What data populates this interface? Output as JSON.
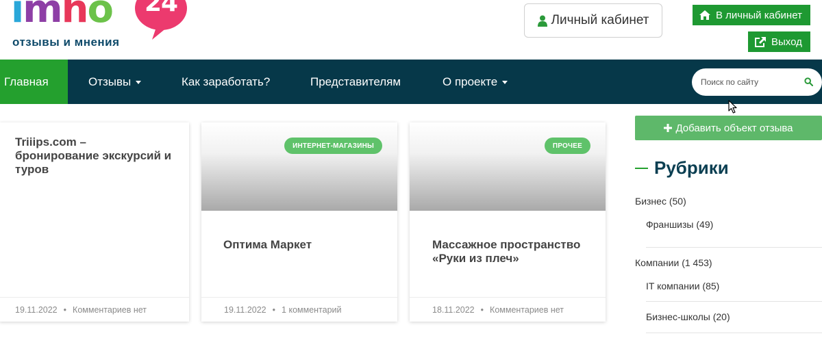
{
  "header": {
    "logo": {
      "letters": [
        "i",
        "m",
        "h",
        "o"
      ],
      "badge": "24",
      "tagline": "отзывы и мнения"
    },
    "cabinet_button": "Личный кабинет",
    "to_cabinet_button": "В личный кабинет",
    "logout_button": "Выход"
  },
  "nav": {
    "items": [
      {
        "label": "Главная",
        "active": true
      },
      {
        "label": "Отзывы",
        "dropdown": true
      },
      {
        "label": "Как заработать?"
      },
      {
        "label": "Представителям"
      },
      {
        "label": "О проекте",
        "dropdown": true
      }
    ],
    "search_placeholder": "Поиск по сайту"
  },
  "cards": [
    {
      "title": "Triiips.com – бронирование экскурсий и туров",
      "date": "19.11.2022",
      "comments": "Комментариев нет"
    },
    {
      "badge": "ИНТЕРНЕТ-МАГАЗИНЫ",
      "title": "Оптима Маркет",
      "date": "19.11.2022",
      "comments": "1 комментарий"
    },
    {
      "badge": "ПРОЧЕЕ",
      "title": "Массажное пространство «Руки из плеч»",
      "date": "18.11.2022",
      "comments": "Комментариев нет"
    }
  ],
  "sidebar": {
    "add_button": "Добавить объект отзыва",
    "rubrics_title": "Рубрики",
    "categories": [
      {
        "name": "Бизнес",
        "count": "(50)"
      },
      {
        "name": "Франшизы",
        "count": "(49)"
      },
      {
        "name": "Компании",
        "count": "(1 453)"
      },
      {
        "name": "IT компании",
        "count": "(85)"
      },
      {
        "name": "Бизнес-школы",
        "count": "(20)"
      }
    ]
  },
  "colors": {
    "nav_bg": "#063849",
    "accent_green": "#1e9932",
    "badge_green": "#5fc26a",
    "title_blue": "#0b3f52"
  },
  "icons": [
    "user-icon",
    "home-icon",
    "external-link-icon",
    "search-icon",
    "plus-icon",
    "caret-down-icon",
    "mouse-cursor-icon"
  ]
}
